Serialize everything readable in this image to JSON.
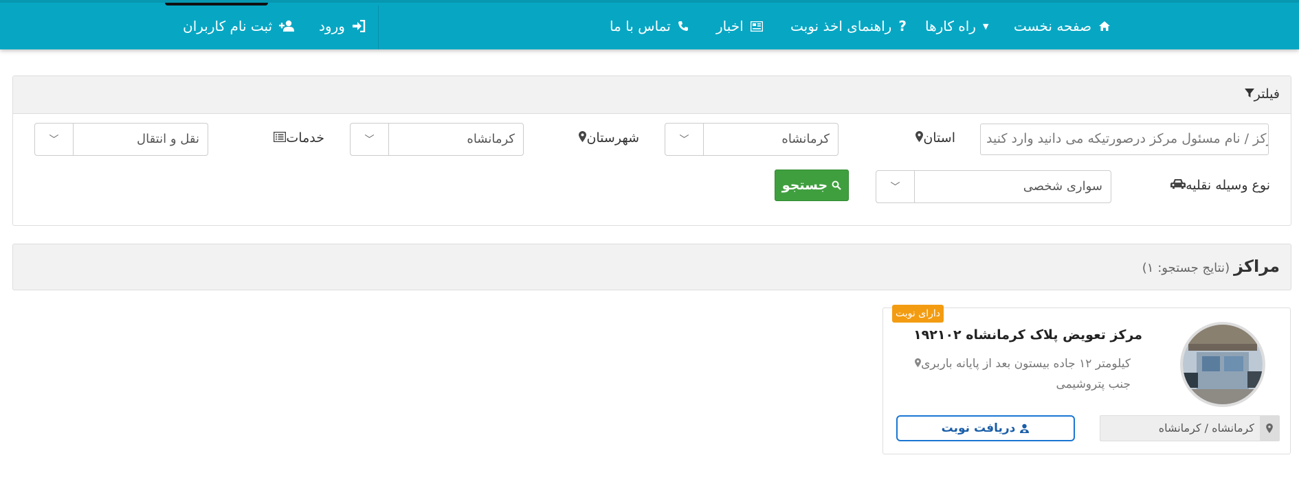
{
  "nav": {
    "home": "صفحه نخست",
    "guides": "راه کارها",
    "booking_guide": "راهنمای اخذ نوبت",
    "news": "اخبار",
    "contact": "تماس با ما",
    "login": "ورود",
    "register": "ثبت نام کاربران"
  },
  "filter": {
    "title": "فیلتر",
    "search_placeholder": "کد مرکز / نام مسئول مرکز درصورتیکه می دانید وارد کنید",
    "province_label": "استان",
    "province_value": "کرمانشاه",
    "city_label": "شهرستان",
    "city_value": "کرمانشاه",
    "services_label": "خدمات",
    "services_value": "نقل و انتقال",
    "vehicle_label": "نوع وسیله نقلیه",
    "vehicle_value": "سواری شخصی",
    "search_button": "جستجو"
  },
  "results": {
    "title": "مراکز",
    "count_text": "(نتایج جستجو: ۱)"
  },
  "center": {
    "badge": "دارای نوبت",
    "name": "مرکز تعویض پلاک کرمانشاه ۱۹۲۱۰۲",
    "address": "کیلومتر ۱۲ جاده بیستون بعد از پایانه باربری جنب پتروشیمی",
    "location": "کرمانشاه / کرمانشاه",
    "get_turn_button": "دریافت نوبت"
  },
  "colors": {
    "topbar": "#07a7c4",
    "search_button": "#3f9f3f",
    "badge": "#f39c12",
    "turn_button": "#1976d2"
  }
}
